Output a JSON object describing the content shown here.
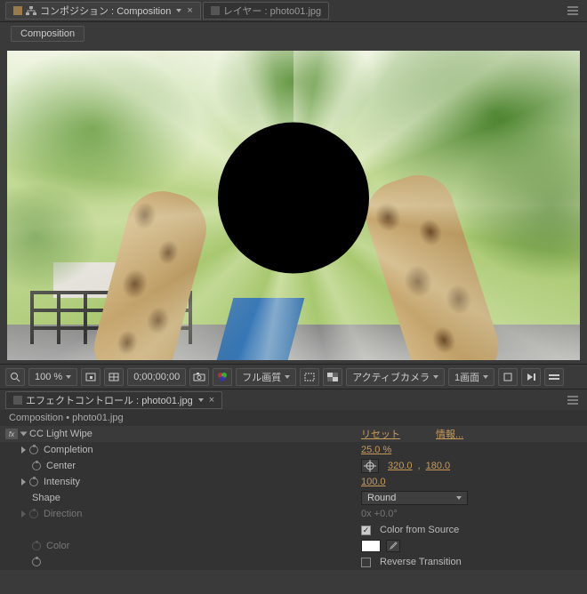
{
  "tabs": {
    "comp_label_prefix": "コンポジション :",
    "comp_name": "Composition",
    "layer_label_prefix": "レイヤー :",
    "layer_name": "photo01.jpg"
  },
  "menu": {
    "composition": "Composition"
  },
  "footer": {
    "zoom": "100 %",
    "timecode": "0;00;00;00",
    "quality": "フル画質",
    "camera": "アクティブカメラ",
    "views": "1画面"
  },
  "panel2": {
    "tab_label_prefix": "エフェクトコントロール :",
    "tab_name": "photo01.jpg",
    "breadcrumb": "Composition • photo01.jpg"
  },
  "effect": {
    "name": "CC Light Wipe",
    "reset": "リセット",
    "about": "情報...",
    "props": {
      "completion_label": "Completion",
      "completion_value": "25.0 %",
      "center_label": "Center",
      "center_x": "320.0",
      "center_y": "180.0",
      "intensity_label": "Intensity",
      "intensity_value": "100.0",
      "shape_label": "Shape",
      "shape_value": "Round",
      "direction_label": "Direction",
      "direction_value": "0x +0.0°",
      "color_from_source_label": "Color from Source",
      "color_label": "Color",
      "reverse_label": "Reverse Transition"
    }
  }
}
